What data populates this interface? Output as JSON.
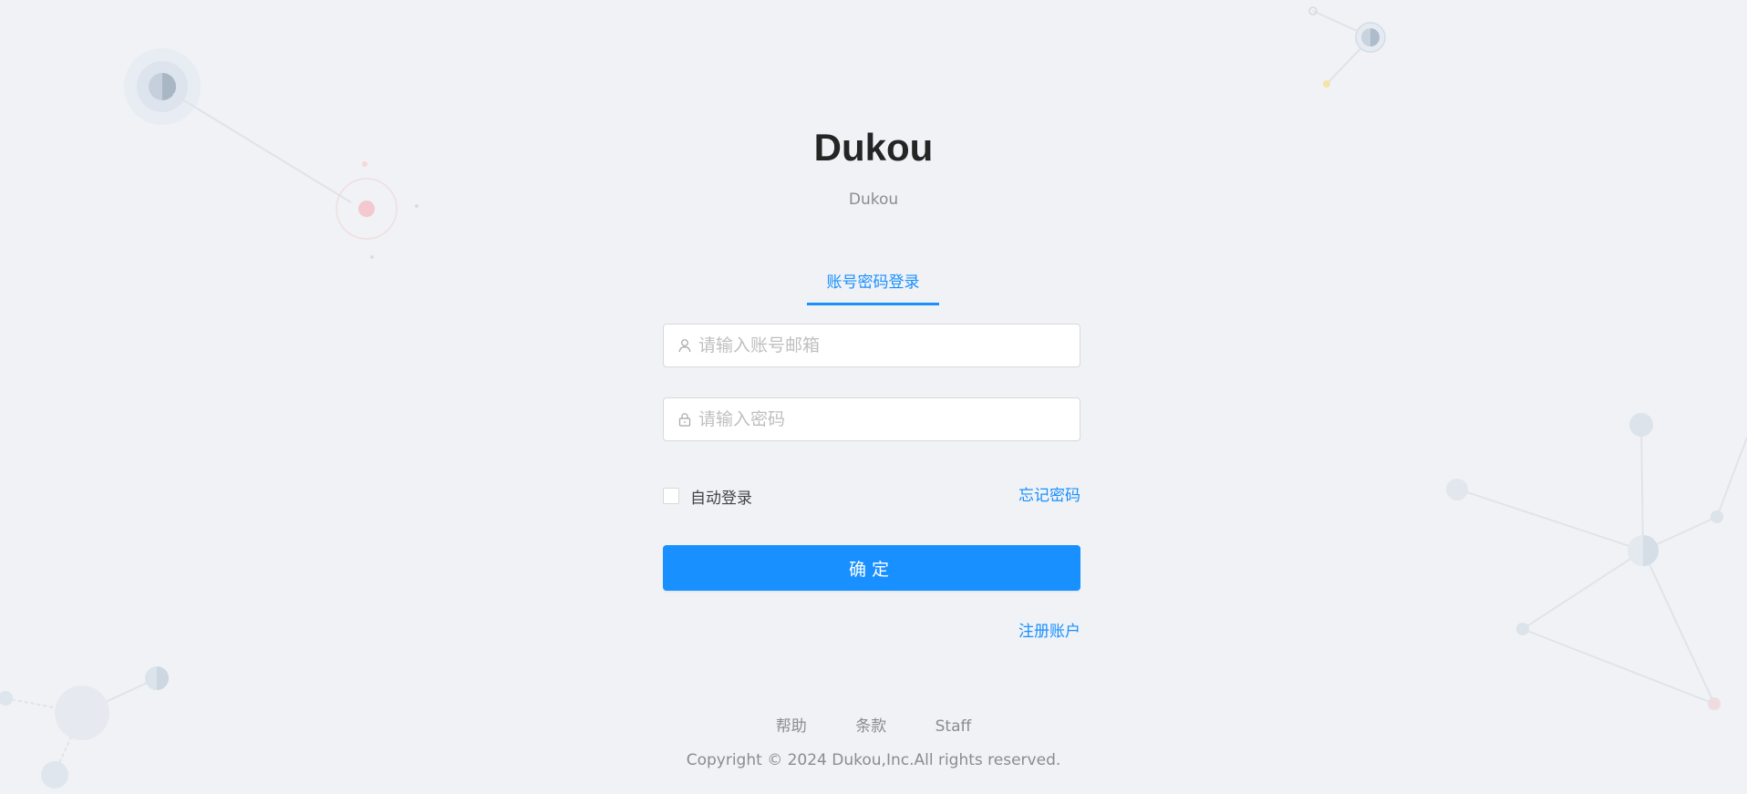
{
  "app": {
    "title": "Dukou",
    "subtitle": "Dukou"
  },
  "login": {
    "tab_label": "账号密码登录",
    "account": {
      "placeholder": "请输入账号邮箱",
      "value": "",
      "icon": "user-icon"
    },
    "password": {
      "placeholder": "请输入密码",
      "value": "",
      "icon": "lock-icon"
    },
    "remember_label": "自动登录",
    "remember_checked": false,
    "forgot_label": "忘记密码",
    "submit_label": "确定",
    "register_label": "注册账户"
  },
  "footer": {
    "links": [
      "帮助",
      "条款",
      "Staff"
    ],
    "copyright": "Copyright © 2024 Dukou,Inc.All rights reserved."
  },
  "colors": {
    "primary": "#1890ff",
    "background": "#f0f2f5",
    "text_secondary": "#8c8c8c"
  }
}
